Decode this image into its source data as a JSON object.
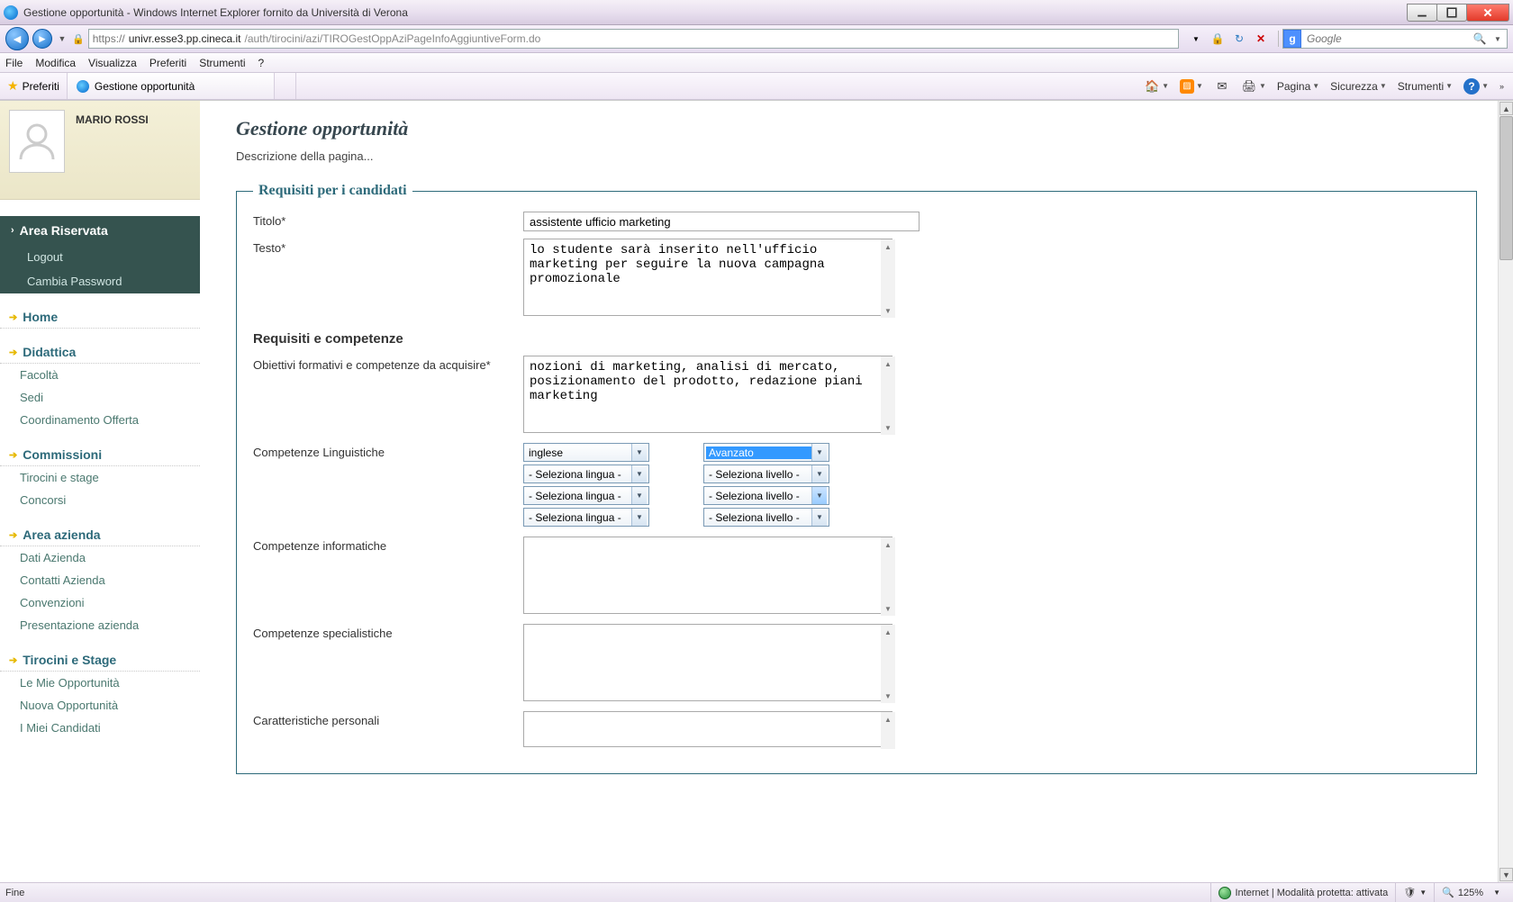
{
  "window": {
    "title": "Gestione opportunità - Windows Internet Explorer fornito da Università di Verona"
  },
  "address": {
    "protocol": "https://",
    "host": "univr.esse3.pp.cineca.it",
    "path": "/auth/tirocini/azi/TIROGestOppAziPageInfoAggiuntiveForm.do"
  },
  "search": {
    "provider": "g",
    "placeholder": "Google"
  },
  "menus": {
    "file": "File",
    "modifica": "Modifica",
    "visualizza": "Visualizza",
    "preferiti": "Preferiti",
    "strumenti": "Strumenti",
    "help": "?"
  },
  "cmdbar": {
    "favorites": "Preferiti",
    "tab_title": "Gestione opportunità",
    "pagina": "Pagina",
    "sicurezza": "Sicurezza",
    "strumenti": "Strumenti"
  },
  "user": {
    "name": "MARIO ROSSI"
  },
  "nav": {
    "area_riservata": "Area Riservata",
    "logout": "Logout",
    "cambia_pw": "Cambia Password",
    "home": "Home",
    "didattica": "Didattica",
    "facolta": "Facoltà",
    "sedi": "Sedi",
    "coord": "Coordinamento Offerta",
    "commissioni": "Commissioni",
    "tir_stage": "Tirocini e stage",
    "concorsi": "Concorsi",
    "area_azienda": "Area azienda",
    "dati_az": "Dati Azienda",
    "contatti_az": "Contatti Azienda",
    "convenzioni": "Convenzioni",
    "pres_az": "Presentazione azienda",
    "tirocini_stage_h": "Tirocini e Stage",
    "mie_opp": "Le Mie Opportunità",
    "nuova_opp": "Nuova Opportunità",
    "miei_cand": "I Miei Candidati"
  },
  "page": {
    "title": "Gestione opportunità",
    "desc": "Descrizione della pagina..."
  },
  "fieldset": {
    "legend": "Requisiti per i candidati",
    "titolo_lbl": "Titolo*",
    "titolo_val": "assistente ufficio marketing",
    "testo_lbl": "Testo*",
    "testo_val": "lo studente sarà inserito nell'ufficio marketing per seguire la nuova campagna promozionale",
    "sub_req": "Requisiti e competenze",
    "obiettivi_lbl": "Obiettivi formativi e competenze da acquisire*",
    "obiettivi_val": "nozioni di marketing, analisi di mercato, posizionamento del prodotto, redazione piani marketing",
    "ling_lbl": "Competenze Linguistiche",
    "lang_rows": [
      {
        "lang": "inglese",
        "level": "Avanzato",
        "hl": true
      },
      {
        "lang": "- Seleziona lingua -",
        "level": "- Seleziona livello -",
        "hl": false
      },
      {
        "lang": "- Seleziona lingua -",
        "level": "- Seleziona livello -",
        "hl": false,
        "btn_hl": true
      },
      {
        "lang": "- Seleziona lingua -",
        "level": "- Seleziona livello -",
        "hl": false
      }
    ],
    "info_lbl": "Competenze informatiche",
    "spec_lbl": "Competenze specialistiche",
    "pers_lbl": "Caratteristiche personali"
  },
  "status": {
    "left": "Fine",
    "zone": "Internet | Modalità protetta: attivata",
    "zoom": "125%"
  }
}
